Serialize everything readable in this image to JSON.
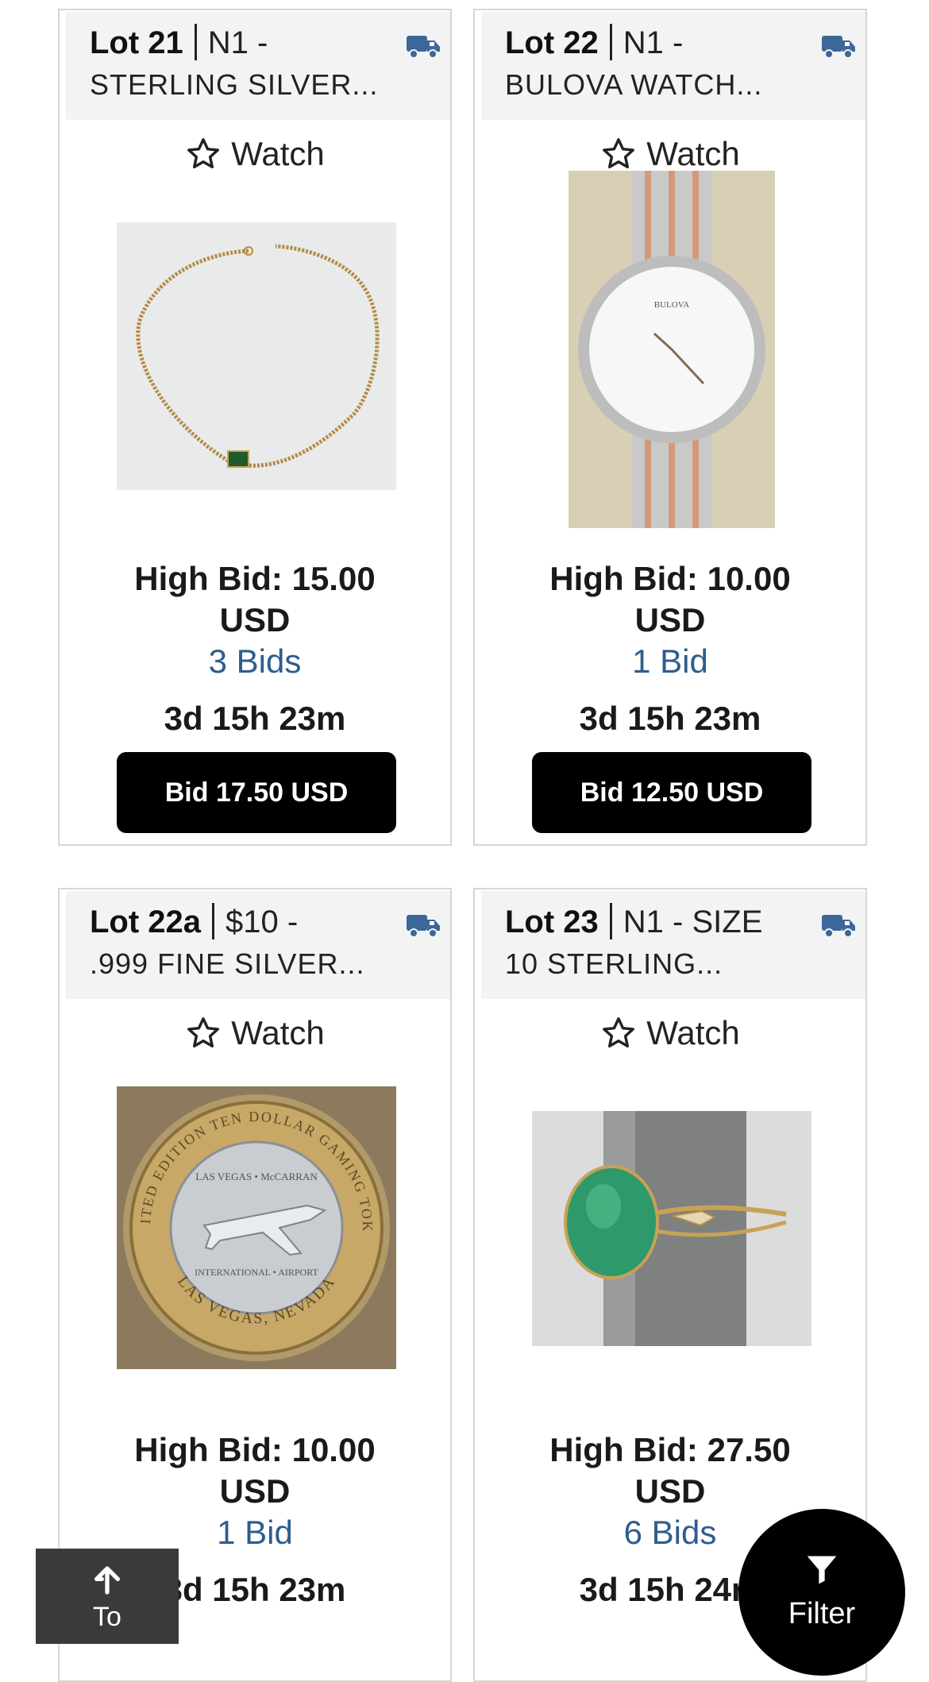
{
  "lots": [
    {
      "lot": "Lot 21",
      "title_line1": "N1 -",
      "title_line2": "STERLING SILVER...",
      "watch_label": "Watch",
      "high_bid": "High Bid: 15.00 USD",
      "bid_count": "3 Bids",
      "time_left": "3d 15h 23m",
      "bid_button": "Bid 17.50 USD",
      "image": "gold-chain-necklace-with-green-stone"
    },
    {
      "lot": "Lot 22",
      "title_line1": "N1 -",
      "title_line2": "BULOVA WATCH...",
      "watch_label": "Watch",
      "high_bid": "High Bid: 10.00 USD",
      "bid_count": "1 Bid",
      "time_left": "3d 15h 23m",
      "bid_button": "Bid 12.50 USD",
      "image": "bulova-two-tone-wristwatch",
      "image_text": "BULOVA"
    },
    {
      "lot": "Lot 22a",
      "title_line1": "$10 -",
      "title_line2": ".999 FINE SILVER...",
      "watch_label": "Watch",
      "high_bid": "High Bid: 10.00 USD",
      "bid_count": "1 Bid",
      "time_left": "3d 15h 23m",
      "image": "las-vegas-gaming-token",
      "image_text": [
        "LIMITED EDITION TEN DOLLAR GAMING TOKEN",
        "LAS VEGAS • McCARRAN",
        "INTERNATIONAL • AIRPORT",
        "LAS VEGAS, NEVADA"
      ]
    },
    {
      "lot": "Lot 23",
      "title_line1": "N1 - SIZE",
      "title_line2": "10 STERLING...",
      "watch_label": "Watch",
      "high_bid": "High Bid: 27.50 USD",
      "bid_count": "6 Bids",
      "time_left": "3d 15h 24m",
      "image": "green-stone-ring-on-ring-stand"
    }
  ],
  "colors": {
    "accent": "#2d5d8f",
    "button_bg": "#000000",
    "header_bg": "#f3f3f3",
    "card_border": "#d6d6d6"
  },
  "nav": {
    "to_top_label": "To",
    "filter_label": "Filter"
  },
  "icons": {
    "shipping": "truck-icon",
    "watch": "star-outline-icon",
    "to_top": "arrow-up-icon",
    "filter": "funnel-icon"
  }
}
